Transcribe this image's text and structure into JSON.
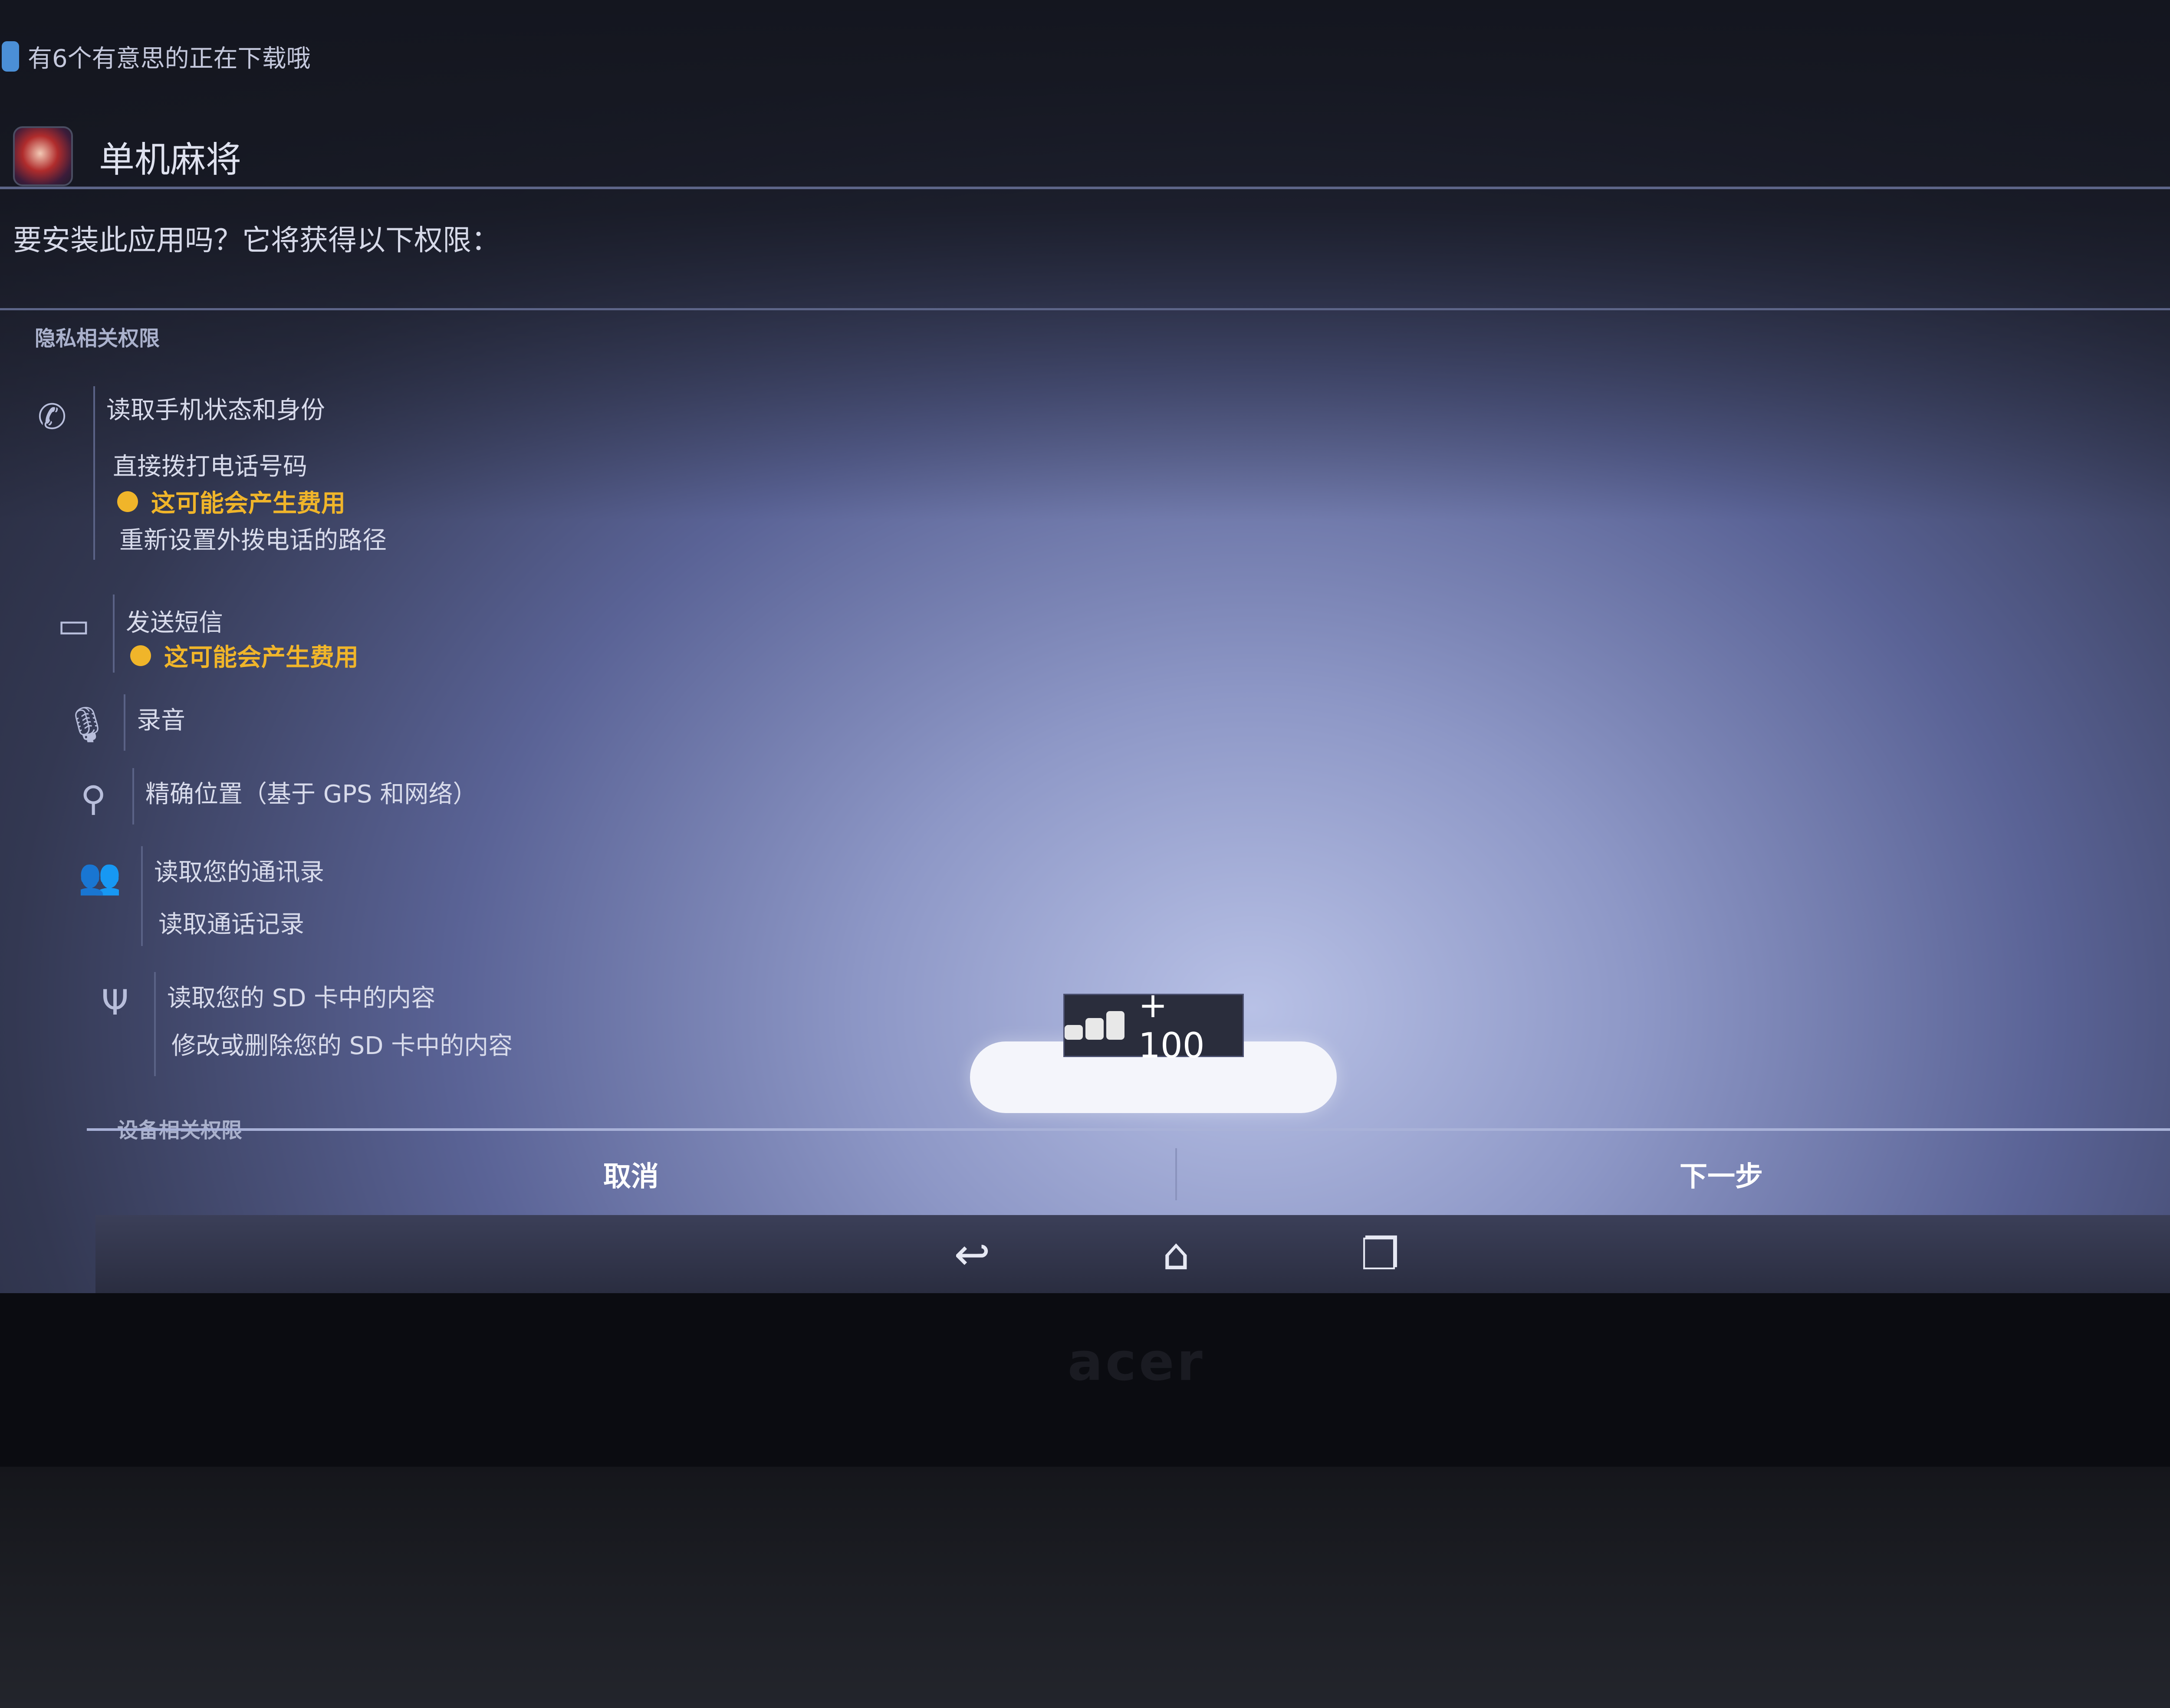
{
  "status_bar": {
    "notification_text": "有6个有意思的正在下载哦"
  },
  "app": {
    "title": "单机麻将",
    "icon": "mahjong-app-icon"
  },
  "install_prompt": "要安装此应用吗？它将获得以下权限：",
  "sections": {
    "privacy": "隐私相关权限",
    "device": "设备相关权限"
  },
  "permissions": {
    "phone": {
      "icon": "phone-icon",
      "items": [
        "读取手机状态和身份",
        "直接拨打电话号码",
        "这可能会产生费用",
        "重新设置外拨电话的路径"
      ]
    },
    "sms": {
      "icon": "message-icon",
      "items": [
        "发送短信",
        "这可能会产生费用"
      ]
    },
    "mic": {
      "icon": "microphone-icon",
      "items": [
        "录音"
      ]
    },
    "location": {
      "icon": "location-pin-icon",
      "items": [
        "精确位置（基于 GPS 和网络）"
      ]
    },
    "contacts": {
      "icon": "people-icon",
      "items": [
        "读取您的通讯录",
        "读取通话记录"
      ]
    },
    "storage": {
      "icon": "usb-icon",
      "items": [
        "读取您的 SD 卡中的内容",
        "修改或删除您的 SD 卡中的内容"
      ]
    }
  },
  "reward_popup": {
    "text": "+ 100",
    "icon": "coins-icon"
  },
  "buttons": {
    "cancel": "取消",
    "next": "下一步"
  },
  "nav": {
    "back": "back-icon",
    "home": "home-icon",
    "recents": "recents-icon"
  },
  "bezel": {
    "brand": "acer"
  },
  "colors": {
    "warning": "#f0b52a",
    "accent_line": "#a9b2d8"
  }
}
